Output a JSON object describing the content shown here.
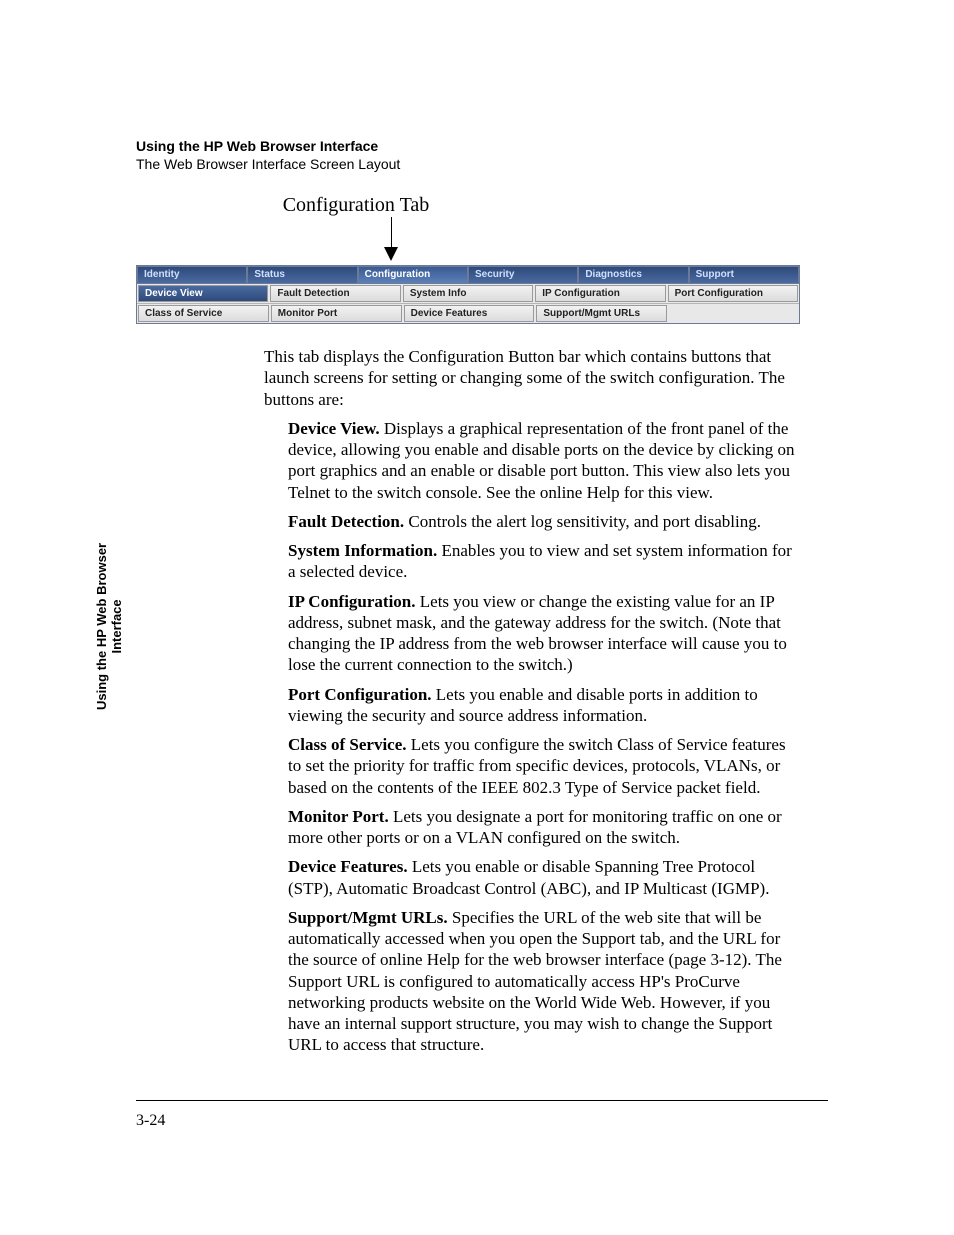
{
  "header": {
    "title": "Using the HP Web Browser Interface",
    "subtitle": "The Web Browser Interface Screen Layout"
  },
  "callout": "Configuration Tab",
  "tabs": [
    "Identity",
    "Status",
    "Configuration",
    "Security",
    "Diagnostics",
    "Support"
  ],
  "active_tab_index": 2,
  "sub_buttons_row1": [
    "Device View",
    "Fault Detection",
    "System Info",
    "IP Configuration",
    "Port Configuration"
  ],
  "sub_active_row1_index": 0,
  "sub_buttons_row2": [
    "Class of Service",
    "Monitor Port",
    "Device Features",
    "Support/Mgmt URLs",
    ""
  ],
  "intro": "This tab displays the Configuration Button bar which contains buttons that launch screens for setting or changing some of the switch configuration. The buttons are:",
  "features": [
    {
      "name": "Device View.",
      "desc": "Displays a graphical representation of the front panel of the device, allowing you enable and disable ports on the device by clicking on port graphics and an enable or disable port button. This view also lets you Telnet to the switch console. See the online Help for this view."
    },
    {
      "name": "Fault Detection.",
      "desc": "Controls the alert log sensitivity, and port disabling."
    },
    {
      "name": "System Information.",
      "desc": "Enables you to view and set system information for a selected device."
    },
    {
      "name": "IP Configuration.",
      "desc": "Lets you view or change the existing value for an IP address, subnet mask, and the gateway address for the switch. (Note that changing the IP address from the web browser interface will cause you to lose the current connection to the switch.)"
    },
    {
      "name": "Port Configuration.",
      "desc": "Lets you enable and disable ports in addition to viewing the security and source address information."
    },
    {
      "name": "Class of Service.",
      "desc": "Lets you configure the switch Class of Service features to set the priority for traffic from specific devices, protocols, VLANs, or based on the contents of the IEEE 802.3 Type of Service packet field."
    },
    {
      "name": "Monitor Port.",
      "desc": "Lets you designate a port for monitoring traffic on one or more other ports or on a VLAN configured on the switch."
    },
    {
      "name": "Device Features.",
      "desc": "Lets you enable or disable Spanning Tree Protocol (STP), Automatic Broadcast Control (ABC), and IP Multicast (IGMP)."
    },
    {
      "name": "Support/Mgmt URLs.",
      "desc": "Specifies the URL of the web site that will be automatically accessed when you open the Support tab, and the URL for the source of online Help for the web browser interface (page 3-12). The Support URL is configured to automatically access HP's ProCurve networking products website on the World Wide Web. However, if you have an internal support structure, you may wish to change the Support URL to access that structure."
    }
  ],
  "side_label_line1": "Using the HP Web Browser",
  "side_label_line2": "Interface",
  "page_number": "3-24"
}
